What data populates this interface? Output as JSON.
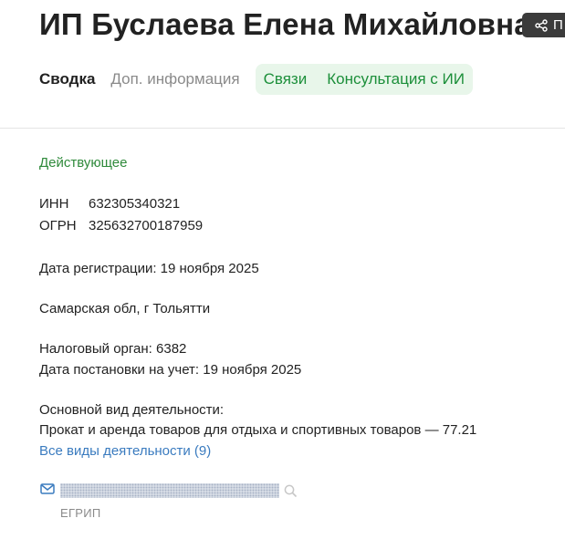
{
  "header": {
    "title": "ИП Буслаева Елена Михайловна",
    "share_label": "П"
  },
  "tabs": {
    "summary": "Сводка",
    "extra_info": "Доп. информация",
    "connections": "Связи",
    "ai_consult": "Консультация с ИИ"
  },
  "company": {
    "status": "Действующее",
    "inn_label": "ИНН",
    "inn_value": "632305340321",
    "ogrn_label": "ОГРН",
    "ogrn_value": "325632700187959",
    "registration": "Дата регистрации: 19 ноября 2025",
    "address": "Самарская обл, г Тольятти",
    "tax_authority": "Налоговый орган: 6382",
    "tax_registration": "Дата постановки на учет: 19 ноября 2025",
    "main_activity_label": "Основной вид деятельности:",
    "main_activity_value": "Прокат и аренда товаров для отдыха и спортивных товаров — 77.21",
    "all_activities_link": "Все виды деятельности (9)"
  },
  "contact": {
    "source": "ЕГРИП"
  },
  "colors": {
    "accent_green": "#1c8f3a",
    "tab_bg": "#e8f6ea",
    "link_blue": "#3a7bbf"
  }
}
